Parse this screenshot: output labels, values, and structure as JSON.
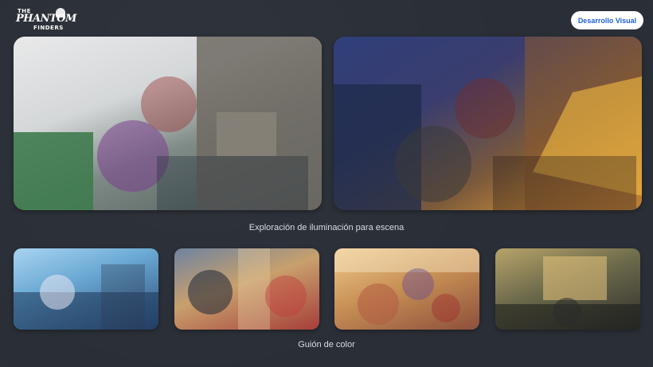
{
  "brand": {
    "logo_line1": "THE",
    "logo_line2": "PHANTOM",
    "logo_line3": "FINDERS"
  },
  "header": {
    "cta_label": "Desarrollo Visual"
  },
  "sections": {
    "lighting": {
      "caption": "Exploración de iluminación para escena"
    },
    "color_script": {
      "caption": "Guión de color"
    }
  },
  "colors": {
    "background": "#2a2f37",
    "accent_text": "#1f5fd6"
  }
}
